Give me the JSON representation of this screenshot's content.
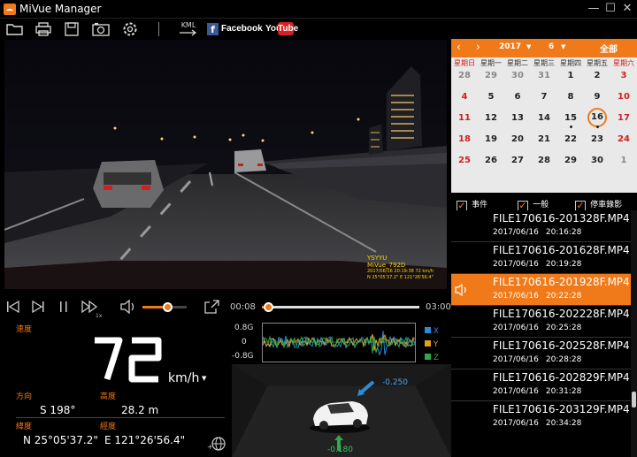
{
  "app": {
    "title": "MiVue Manager",
    "controls": {
      "min": "—",
      "max": "☐",
      "close": "✕"
    }
  },
  "toolbar": {
    "kml": "KML",
    "facebook": "Facebook",
    "youtube_you": "You",
    "youtube_tube": "Tube"
  },
  "video": {
    "overlay_brand": "YSYYU",
    "overlay_model": "MiVue_792D",
    "overlay_line1": "2017/06/16  20:19:38  72 km/h",
    "overlay_line2": "N 25°05'37.2\" E 121°26'56.4\""
  },
  "player": {
    "time_current": "00:08",
    "time_total": "03:00",
    "volume": 0.55,
    "progress": 0.04,
    "speed_label": "1x"
  },
  "calendar": {
    "year": "2017",
    "month": "6",
    "all_label": "全部",
    "weekdays": [
      "星期日",
      "星期一",
      "星期二",
      "星期三",
      "星期四",
      "星期五",
      "星期六"
    ],
    "weeks": [
      [
        "28",
        "29",
        "30",
        "31",
        "1",
        "2",
        "3"
      ],
      [
        "4",
        "5",
        "6",
        "7",
        "8",
        "9",
        "10"
      ],
      [
        "11",
        "12",
        "13",
        "14",
        "15",
        "16",
        "17"
      ],
      [
        "18",
        "19",
        "20",
        "21",
        "22",
        "23",
        "24"
      ],
      [
        "25",
        "26",
        "27",
        "28",
        "29",
        "30",
        "1"
      ]
    ],
    "selected_day": "16"
  },
  "filters": {
    "event": "事件",
    "general": "一般",
    "parking": "停車錄影"
  },
  "files": [
    {
      "name": "FILE170616-201328F.MP4",
      "date": "2017/06/16",
      "time": "20:16:28"
    },
    {
      "name": "FILE170616-201628F.MP4",
      "date": "2017/06/16",
      "time": "20:19:28"
    },
    {
      "name": "FILE170616-201928F.MP4",
      "date": "2017/06/16",
      "time": "20:22:28"
    },
    {
      "name": "FILE170616-202228F.MP4",
      "date": "2017/06/16",
      "time": "20:25:28"
    },
    {
      "name": "FILE170616-202528F.MP4",
      "date": "2017/06/16",
      "time": "20:28:28"
    },
    {
      "name": "FILE170616-202829F.MP4",
      "date": "2017/06/16",
      "time": "20:31:28"
    },
    {
      "name": "FILE170616-203129F.MP4",
      "date": "2017/06/16",
      "time": "20:34:28"
    }
  ],
  "info": {
    "speed_label": "速度",
    "speed_value": "72",
    "speed_unit": "km/h",
    "heading_label": "方向",
    "heading_value": "S 198°",
    "altitude_label": "高度",
    "altitude_value": "28.2  m",
    "lat_label": "緯度",
    "lat_value": "N 25°05'37.2\"",
    "lon_label": "經度",
    "lon_value": "E 121°26'56.4\""
  },
  "gsensor": {
    "ticks": [
      "0.8G",
      "0",
      "-0.8G"
    ],
    "legend": [
      "X",
      "Y",
      "Z"
    ],
    "colors": {
      "x": "#2a8cd8",
      "y": "#e0a020",
      "z": "#2ea84a"
    }
  },
  "car3d": {
    "right_value": "-0.250",
    "bottom_value": "-0.180"
  }
}
